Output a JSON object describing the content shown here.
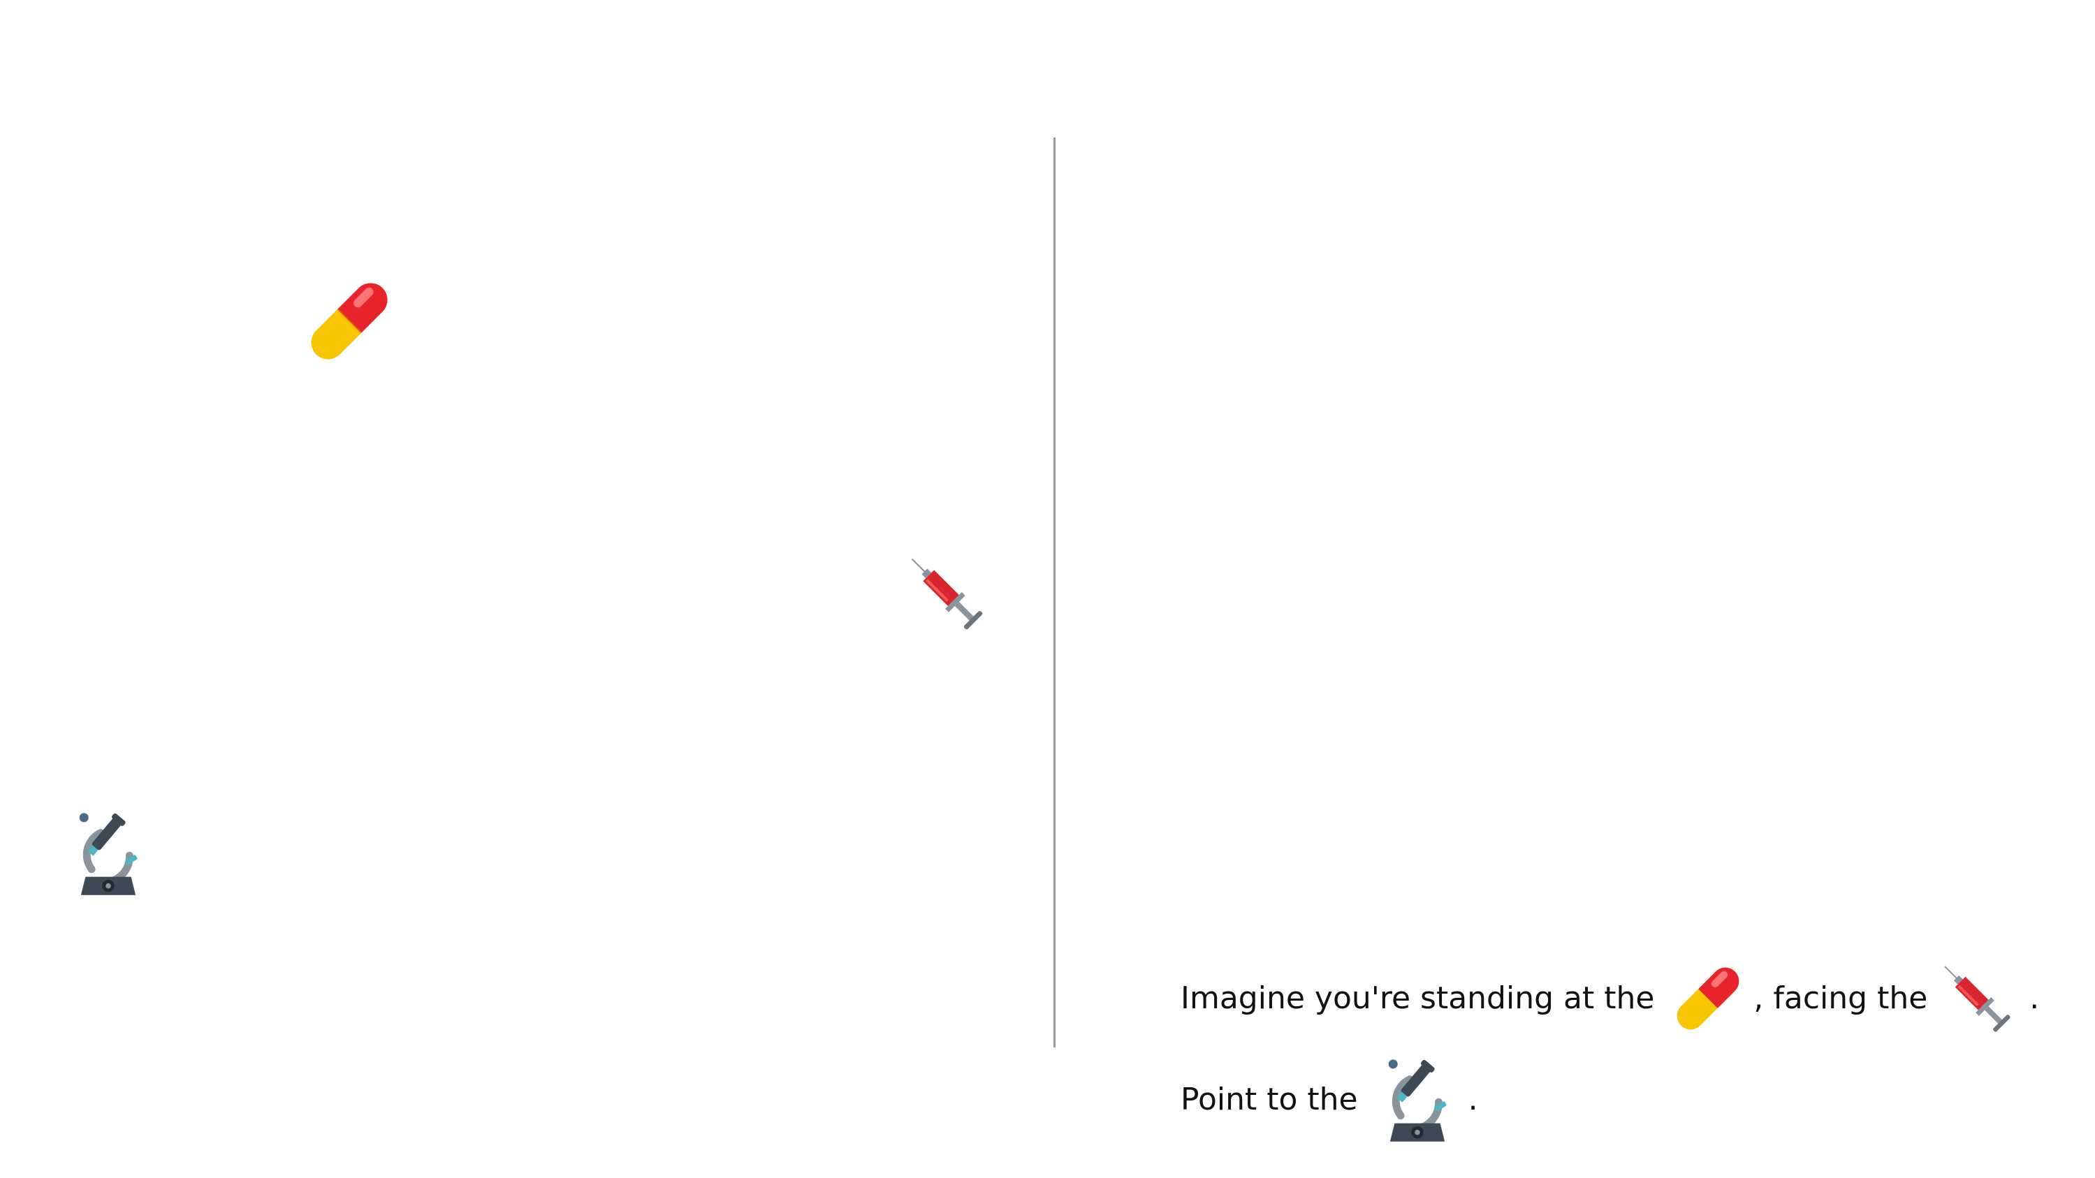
{
  "scene": {
    "icons": [
      {
        "name": "pill",
        "label": "pill-icon"
      },
      {
        "name": "syringe",
        "label": "syringe-icon"
      },
      {
        "name": "microscope",
        "label": "microscope-icon"
      }
    ]
  },
  "prompt": {
    "line1": {
      "prefix": "Imagine you're standing at the",
      "middle": ", facing the",
      "suffix": "."
    },
    "line2": {
      "prefix": "Point to the",
      "suffix": "."
    }
  },
  "colors": {
    "pill_red": "#e8232b",
    "pill_yellow": "#f7c600",
    "syringe_red": "#d9262e",
    "metal": "#8a949c",
    "microscope_body": "#7b8790",
    "microscope_dark": "#3d4a55",
    "microscope_accent": "#4db6c4",
    "divider": "#9a9a9a"
  }
}
